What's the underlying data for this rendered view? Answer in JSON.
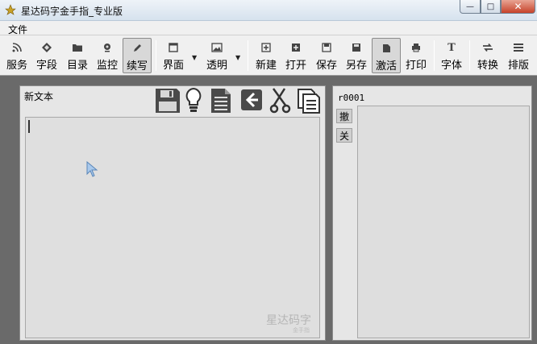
{
  "window": {
    "title": "星达码字金手指_专业版",
    "close_glyph": "✕",
    "minimize_glyph": "—",
    "maximize_glyph": "□"
  },
  "menu": {
    "file": "文件"
  },
  "toolbar": {
    "items": [
      {
        "label": "服务",
        "icon": "rss-icon"
      },
      {
        "label": "字段",
        "icon": "diamond-icon"
      },
      {
        "label": "目录",
        "icon": "folder-icon"
      },
      {
        "label": "监控",
        "icon": "monitor-icon"
      },
      {
        "label": "续写",
        "icon": "pen-icon",
        "active": true
      },
      {
        "label": "界面",
        "icon": "window-icon"
      },
      {
        "label": "透明",
        "icon": "image-icon"
      },
      {
        "label": "新建",
        "icon": "plus-square-icon"
      },
      {
        "label": "打开",
        "icon": "open-icon"
      },
      {
        "label": "保存",
        "icon": "save-icon"
      },
      {
        "label": "另存",
        "icon": "save-as-icon"
      },
      {
        "label": "激活",
        "icon": "activate-icon",
        "active": true
      },
      {
        "label": "打印",
        "icon": "printer-icon"
      },
      {
        "label": "字体",
        "icon": "font-icon"
      },
      {
        "label": "转换",
        "icon": "convert-icon"
      },
      {
        "label": "排版",
        "icon": "layout-icon"
      }
    ]
  },
  "editor": {
    "title": "新文本",
    "watermark": "星达码字",
    "watermark_small": "金手指"
  },
  "sidepanel": {
    "title": "r0001",
    "undo_label": "撤",
    "close_label": "关"
  }
}
